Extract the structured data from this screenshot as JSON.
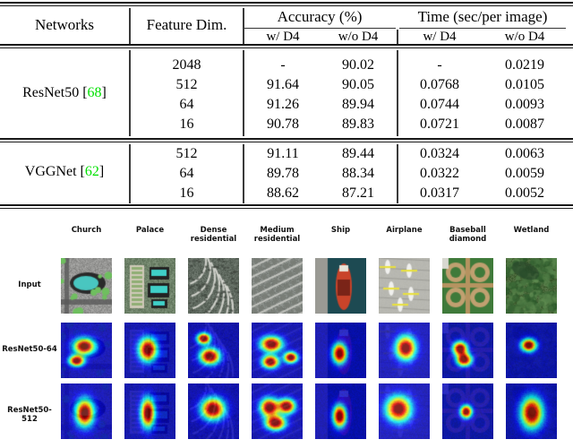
{
  "table": {
    "columns": {
      "networks": "Networks",
      "feature_dim": "Feature  Dim.",
      "accuracy": "Accuracy (%)",
      "time": "Time (sec/per image)",
      "sub_w_d4": "w/ D4",
      "sub_wo_d4": "w/o D4"
    },
    "groups": [
      {
        "network_name": "ResNet50",
        "network_cite": "68",
        "rows": [
          {
            "dim": "2048",
            "acc_w": "-",
            "acc_wo": "90.02",
            "time_w": "-",
            "time_wo": "0.0219"
          },
          {
            "dim": "512",
            "acc_w": "91.64",
            "acc_wo": "90.05",
            "time_w": "0.0768",
            "time_wo": "0.0105"
          },
          {
            "dim": "64",
            "acc_w": "91.26",
            "acc_wo": "89.94",
            "time_w": "0.0744",
            "time_wo": "0.0093"
          },
          {
            "dim": "16",
            "acc_w": "90.78",
            "acc_wo": "89.83",
            "time_w": "0.0721",
            "time_wo": "0.0087"
          }
        ]
      },
      {
        "network_name": "VGGNet",
        "network_cite": "62",
        "rows": [
          {
            "dim": "512",
            "acc_w": "91.11",
            "acc_wo": "89.44",
            "time_w": "0.0324",
            "time_wo": "0.0063"
          },
          {
            "dim": "64",
            "acc_w": "89.78",
            "acc_wo": "88.34",
            "time_w": "0.0322",
            "time_wo": "0.0059"
          },
          {
            "dim": "16",
            "acc_w": "88.62",
            "acc_wo": "87.21",
            "time_w": "0.0317",
            "time_wo": "0.0052"
          }
        ]
      }
    ]
  },
  "figure": {
    "column_titles": [
      "Church",
      "Palace",
      "Dense\nresidential",
      "Medium\nresidential",
      "Ship",
      "Airplane",
      "Baseball\ndiamond",
      "Wetland"
    ],
    "row_labels": [
      "Input",
      "ResNet50-64",
      "ResNet50-512"
    ]
  },
  "colors": {
    "citation_green": "#00e000",
    "rule_black": "#1a1a1a",
    "text_black": "#000000"
  }
}
